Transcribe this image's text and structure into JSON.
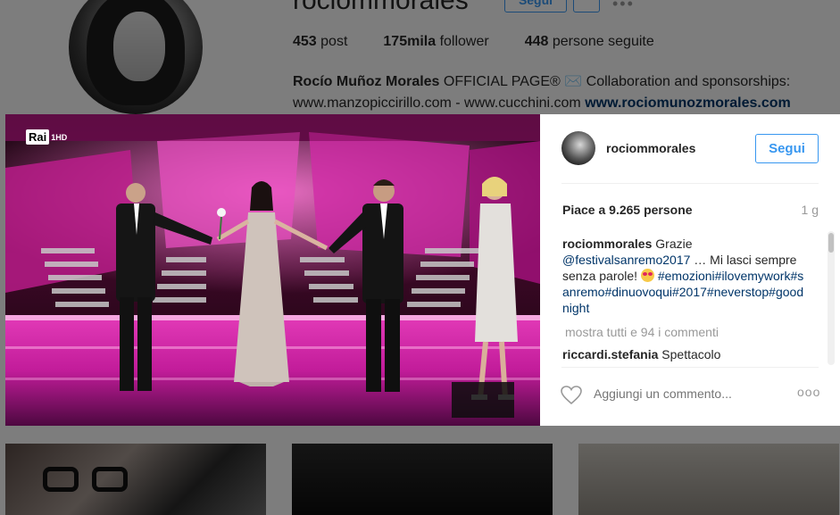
{
  "profile": {
    "username": "rociommorales",
    "follow_label": "Segui",
    "more_label": "•••",
    "stats": {
      "posts": "453",
      "posts_label": "post",
      "followers": "175mila",
      "followers_label": "follower",
      "following": "448",
      "following_label": "persone seguite"
    },
    "bio": {
      "name": "Rocío Muñoz Morales",
      "text": "OFFICIAL PAGE® ✉️ Collaboration and sponsorships: www.manzopiccirillo.com - www.cucchini.com",
      "link": "www.rociomunozmorales.com"
    }
  },
  "photo": {
    "channel": "Rai",
    "channel_suffix": "1HD"
  },
  "post": {
    "username": "rociommorales",
    "follow_label": "Segui",
    "likes": "Piace a 9.265 persone",
    "age": "1 g",
    "caption_user": "rociommorales",
    "caption_prefix": "Grazie",
    "caption_mention": "@festivalsanremo2017",
    "caption_text": "… Mi lasci sempre senza parole!",
    "caption_hashtags": "#emozioni#ilovemywork#sanremo#dinuovoqui#2017#neverstop#goodnight",
    "view_all": "mostra tutti e 94 i commenti",
    "comment_user": "riccardi.stefania",
    "comment_text": "Spettacolo",
    "add_comment_placeholder": "Aggiungi un commento...",
    "options_label": "ooo"
  },
  "colors": {
    "accent": "#3897f0",
    "link": "#003569",
    "muted": "#999999",
    "stage_pink": "#d6249f"
  }
}
